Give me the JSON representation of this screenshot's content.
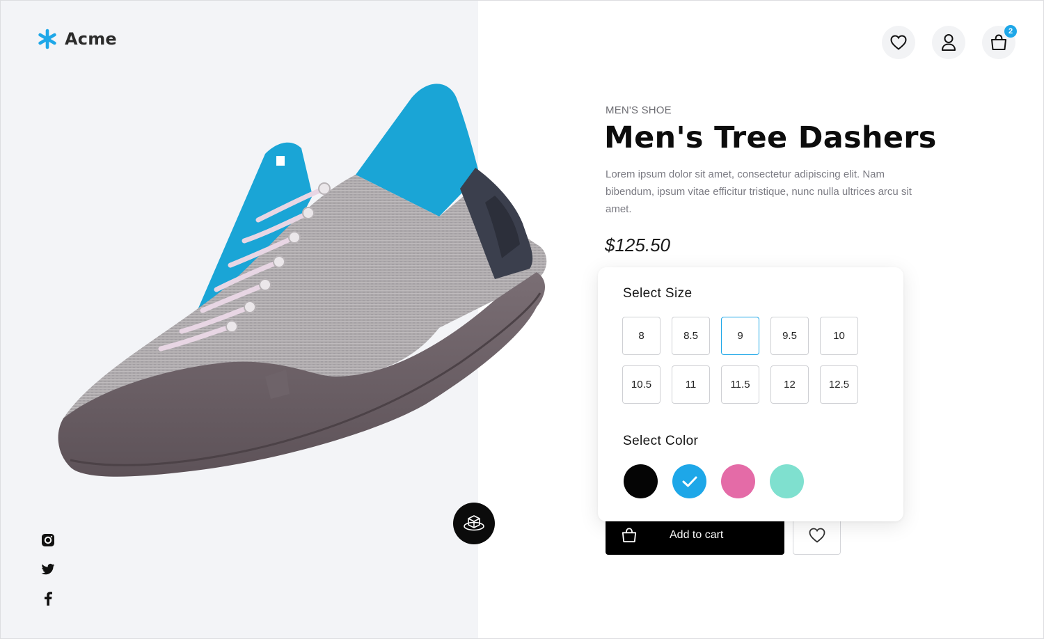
{
  "brand": {
    "name": "Acme",
    "accent": "#1ea7e8"
  },
  "header": {
    "icons": [
      "heart-icon",
      "user-icon",
      "shopping-bag-icon"
    ],
    "cart_count": "2"
  },
  "product": {
    "category": "MEN'S SHOE",
    "name": "Men's Tree Dashers",
    "description": "Lorem ipsum dolor sit amet, consectetur adipiscing elit. Nam bibendum, ipsum vitae efficitur tristique, nunc nulla ultrices arcu  sit amet.",
    "price": "$125.50"
  },
  "options": {
    "size_heading": "Select Size",
    "sizes": [
      "8",
      "8.5",
      "9",
      "9.5",
      "10",
      "10.5",
      "11",
      "11.5",
      "12",
      "12.5"
    ],
    "selected_size": "9",
    "color_heading": "Select Color",
    "colors": [
      "#050505",
      "#1ea7e8",
      "#e46ba7",
      "#7fe0cf"
    ],
    "selected_color": "#1ea7e8"
  },
  "actions": {
    "add_to_cart": "Add to cart"
  },
  "social": [
    "instagram-icon",
    "twitter-icon",
    "facebook-icon"
  ]
}
